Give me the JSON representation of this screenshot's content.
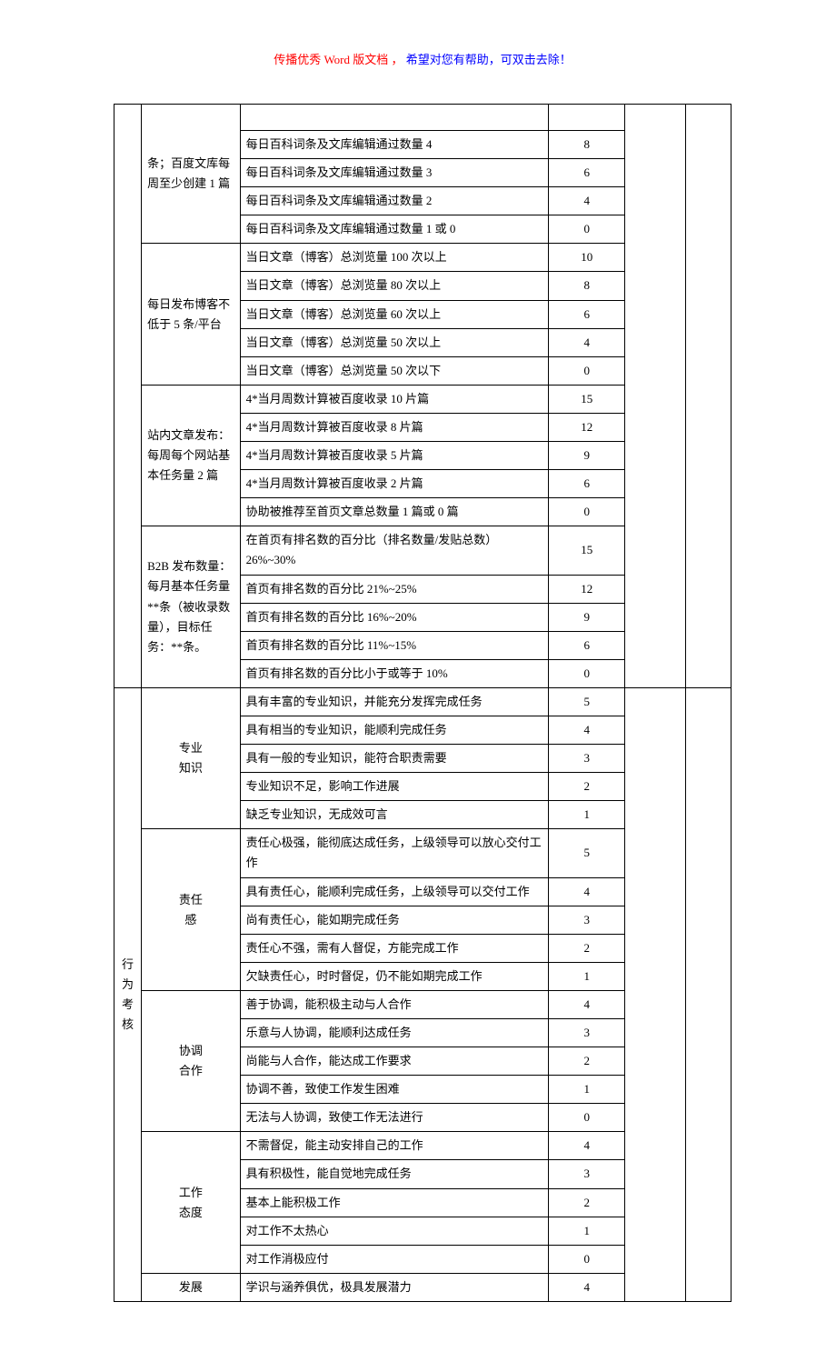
{
  "header": {
    "part1": "传播优秀 Word 版文档 ，",
    "part2": "希望对您有帮助，可双击去除！"
  },
  "col1": {
    "behavior": "行\n为\n考\n核"
  },
  "blocks": {
    "baike": {
      "label": "条；百度文库每周至少创建 1 篇",
      "rows": [
        {
          "desc": "每日百科词条及文库编辑通过数量 4",
          "score": "8"
        },
        {
          "desc": "每日百科词条及文库编辑通过数量 3",
          "score": "6"
        },
        {
          "desc": "每日百科词条及文库编辑通过数量 2",
          "score": "4"
        },
        {
          "desc": "每日百科词条及文库编辑通过数量 1 或 0",
          "score": "0"
        }
      ]
    },
    "blog": {
      "label": "每日发布博客不低于 5 条/平台",
      "rows": [
        {
          "desc": "当日文章（博客）总浏览量 100 次以上",
          "score": "10"
        },
        {
          "desc": "当日文章（博客）总浏览量 80 次以上",
          "score": "8"
        },
        {
          "desc": "当日文章（博客）总浏览量 60 次以上",
          "score": "6"
        },
        {
          "desc": "当日文章（博客）总浏览量 50 次以上",
          "score": "4"
        },
        {
          "desc": "当日文章（博客）总浏览量 50 次以下",
          "score": "0"
        }
      ]
    },
    "site": {
      "label": "站内文章发布：每周每个网站基本任务量 2 篇",
      "rows": [
        {
          "desc": "4*当月周数计算被百度收录 10 片篇",
          "score": "15"
        },
        {
          "desc": "4*当月周数计算被百度收录 8 片篇",
          "score": "12"
        },
        {
          "desc": "4*当月周数计算被百度收录 5 片篇",
          "score": "9"
        },
        {
          "desc": "4*当月周数计算被百度收录 2 片篇",
          "score": "6"
        },
        {
          "desc": "协助被推荐至首页文章总数量 1 篇或 0 篇",
          "score": "0"
        }
      ]
    },
    "b2b": {
      "label": "B2B 发布数量：每月基本任务量  **条（被收录数量），目标任务：**条。",
      "rows": [
        {
          "desc": "在首页有排名数的百分比（排名数量/发贴总数）26%~30%",
          "score": "15"
        },
        {
          "desc": "首页有排名数的百分比 21%~25%",
          "score": "12"
        },
        {
          "desc": "首页有排名数的百分比 16%~20%",
          "score": "9"
        },
        {
          "desc": "首页有排名数的百分比 11%~15%",
          "score": "6"
        },
        {
          "desc": "首页有排名数的百分比小于或等于 10%",
          "score": "0"
        }
      ]
    },
    "pro": {
      "label": "专业\n知识",
      "rows": [
        {
          "desc": "具有丰富的专业知识，并能充分发挥完成任务",
          "score": "5"
        },
        {
          "desc": "具有相当的专业知识，能顺利完成任务",
          "score": "4"
        },
        {
          "desc": "具有一般的专业知识，能符合职责需要",
          "score": "3"
        },
        {
          "desc": "专业知识不足，影响工作进展",
          "score": "2"
        },
        {
          "desc": "缺乏专业知识，无成效可言",
          "score": "1"
        }
      ]
    },
    "resp": {
      "label": "责任\n感",
      "rows": [
        {
          "desc": "责任心极强，能彻底达成任务，上级领导可以放心交付工作",
          "score": "5"
        },
        {
          "desc": "具有责任心，能顺利完成任务，上级领导可以交付工作",
          "score": "4"
        },
        {
          "desc": "尚有责任心，能如期完成任务",
          "score": "3"
        },
        {
          "desc": "责任心不强，需有人督促，方能完成工作",
          "score": "2"
        },
        {
          "desc": "欠缺责任心，时时督促，仍不能如期完成工作",
          "score": "1"
        }
      ]
    },
    "coop": {
      "label": "协调\n合作",
      "rows": [
        {
          "desc": "善于协调，能积极主动与人合作",
          "score": "4"
        },
        {
          "desc": "乐意与人协调，能顺利达成任务",
          "score": "3"
        },
        {
          "desc": "尚能与人合作，能达成工作要求",
          "score": "2"
        },
        {
          "desc": "协调不善，致使工作发生困难",
          "score": "1"
        },
        {
          "desc": "无法与人协调，致使工作无法进行",
          "score": "0"
        }
      ]
    },
    "att": {
      "label": "工作\n态度",
      "rows": [
        {
          "desc": "不需督促，能主动安排自己的工作",
          "score": "4"
        },
        {
          "desc": "具有积极性，能自觉地完成任务",
          "score": "3"
        },
        {
          "desc": "基本上能积极工作",
          "score": "2"
        },
        {
          "desc": "对工作不太热心",
          "score": "1"
        },
        {
          "desc": "对工作消极应付",
          "score": "0"
        }
      ]
    },
    "dev": {
      "label": "发展",
      "rows": [
        {
          "desc": "学识与涵养俱优，极具发展潜力",
          "score": "4"
        }
      ]
    }
  }
}
